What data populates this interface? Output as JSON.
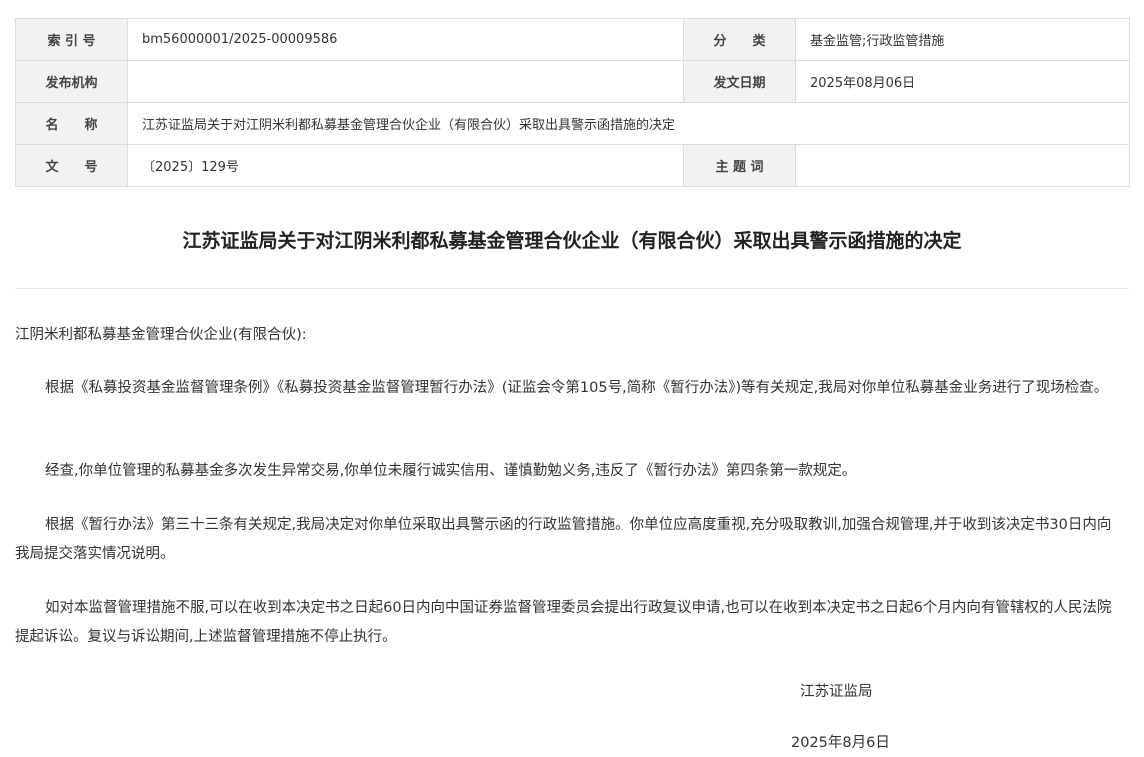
{
  "meta": {
    "index_label": "索 引 号",
    "index_value": "bm56000001/2025-00009586",
    "category_label": "分　　类",
    "category_value": "基金监管;行政监管措施",
    "publisher_label": "发布机构",
    "publisher_value": "",
    "date_label": "发文日期",
    "date_value": "2025年08月06日",
    "name_label": "名　　称",
    "name_value": "江苏证监局关于对江阴米利都私募基金管理合伙企业（有限合伙）采取出具警示函措施的决定",
    "docno_label": "文　　号",
    "docno_value": "〔2025〕129号",
    "subject_label": "主 题 词",
    "subject_value": ""
  },
  "document": {
    "title": "江苏证监局关于对江阴米利都私募基金管理合伙企业（有限合伙）采取出具警示函措施的决定",
    "salutation": "江阴米利都私募基金管理合伙企业(有限合伙):",
    "paragraphs": [
      "根据《私募投资基金监督管理条例》《私募投资基金监督管理暂行办法》(证监会令第105号,简称《暂行办法》)等有关规定,我局对你单位私募基金业务进行了现场检查。",
      "经查,你单位管理的私募基金多次发生异常交易,你单位未履行诚实信用、谨慎勤勉义务,违反了《暂行办法》第四条第一款规定。",
      "根据《暂行办法》第三十三条有关规定,我局决定对你单位采取出具警示函的行政监管措施。你单位应高度重视,充分吸取教训,加强合规管理,并于收到该决定书30日内向我局提交落实情况说明。",
      "如对本监督管理措施不服,可以在收到本决定书之日起60日内向中国证券监督管理委员会提出行政复议申请,也可以在收到本决定书之日起6个月内向有管辖权的人民法院提起诉讼。复议与诉讼期间,上述监督管理措施不停止执行。"
    ],
    "signer": "江苏证监局",
    "sign_date": "2025年8月6日"
  }
}
